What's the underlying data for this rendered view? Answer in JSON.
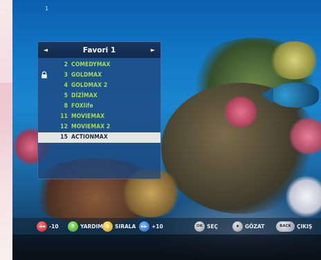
{
  "screen": {
    "corner_number": "1"
  },
  "favorites_panel": {
    "title": "Favori 1",
    "left_arrow": "◄",
    "right_arrow": "►",
    "channels": [
      {
        "number": "2",
        "name": "COMEDYMAX",
        "locked": false,
        "selected": false
      },
      {
        "number": "3",
        "name": "GOLDMAX",
        "locked": true,
        "selected": false
      },
      {
        "number": "4",
        "name": "GOLDMAX 2",
        "locked": false,
        "selected": false
      },
      {
        "number": "5",
        "name": "DİZİMAX",
        "locked": false,
        "selected": false
      },
      {
        "number": "8",
        "name": "FOXlife",
        "locked": false,
        "selected": false
      },
      {
        "number": "11",
        "name": "MOVIEMAX",
        "locked": false,
        "selected": false
      },
      {
        "number": "12",
        "name": "MOVIEMAX 2",
        "locked": false,
        "selected": false
      },
      {
        "number": "15",
        "name": "ACTIONMAX",
        "locked": false,
        "selected": true
      }
    ]
  },
  "bottom_bar": {
    "red": {
      "button_glyph": "◄◄",
      "label": "-10",
      "color": "#c81a1a"
    },
    "green": {
      "button_glyph": "?",
      "label": "YARDIM",
      "color": "#3c9a22"
    },
    "yellow": {
      "button_glyph": "⇅",
      "label": "SIRALA",
      "color": "#d19a10"
    },
    "blue": {
      "button_glyph": "►►",
      "label": "+10",
      "color": "#1d5ec2"
    },
    "ok": {
      "button_glyph": "OK",
      "label": "SEÇ"
    },
    "nav": {
      "button_glyph": "◉",
      "label": "GÖZAT"
    },
    "back": {
      "button_glyph": "BACK",
      "label": "ÇIKIŞ"
    }
  },
  "colors": {
    "channel_text": "#a9dd4a",
    "selected_row_bg": "#e4e6e2",
    "panel_header_bg": "#1a355f"
  }
}
